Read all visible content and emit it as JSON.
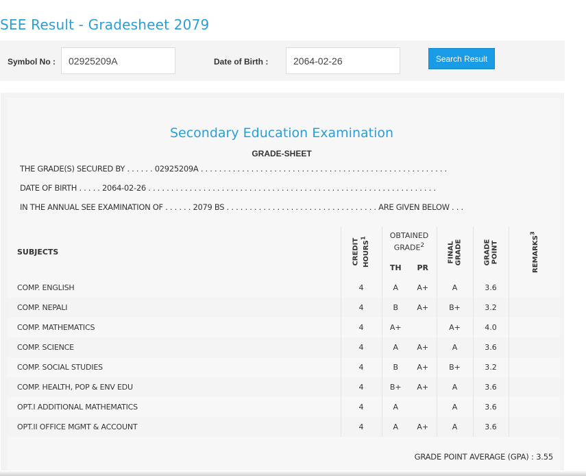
{
  "page": {
    "title": "SEE Result - Gradesheet 2079"
  },
  "search": {
    "symbol_label": "Symbol No :",
    "symbol_value": "02925209A",
    "dob_label": "Date of Birth :",
    "dob_value": "2064-02-26",
    "button_label": "Search Result"
  },
  "sheet": {
    "exam_title": "Secondary Education Examination",
    "heading": "GRADE-SHEET",
    "line1_prefix": "THE GRADE(S) SECURED BY . . . . . .",
    "line1_value": "02925209A",
    "line1_suffix": ". . . . . . . . . . . . . . . . . . . . . . . . . . . . . . . . . . . . . . . . . . . . . . . . . . . . . .",
    "line2_prefix": "DATE OF BIRTH . . . . .",
    "line2_value": "2064-02-26",
    "line2_suffix": ". . . . . . . . . . . . . . . . . . . . . . . . . . . . . . . . . . . . . . . . . . . . . . . . . . . . . . . . . . . . . . .",
    "line3_prefix": "IN THE ANNUAL SEE EXAMINATION OF . . . . . .",
    "line3_value": "2079 BS",
    "line3_suffix": ". . . . . . . . . . . . . . . . . . . . . . . . . . . . . . . . . ARE GIVEN BELOW . . .",
    "columns": {
      "subjects": "SUBJECTS",
      "credit_hours_a": "CREDIT",
      "credit_hours_b": "HOURS",
      "credit_sup": "1",
      "obtained_a": "OBTAINED",
      "obtained_b": "GRADE",
      "obtained_sup": "2",
      "th": "TH",
      "pr": "PR",
      "final_a": "FINAL",
      "final_b": "GRADE",
      "point_a": "GRADE",
      "point_b": "POINT",
      "remarks": "REMARKS",
      "remarks_sup": "3"
    },
    "rows": [
      {
        "subject": "COMP. ENGLISH",
        "credit": "4",
        "th": "A",
        "pr": "A+",
        "final": "A",
        "point": "3.6",
        "remarks": ""
      },
      {
        "subject": "COMP. NEPALI",
        "credit": "4",
        "th": "B",
        "pr": "A+",
        "final": "B+",
        "point": "3.2",
        "remarks": ""
      },
      {
        "subject": "COMP. MATHEMATICS",
        "credit": "4",
        "th": "A+",
        "pr": "",
        "final": "A+",
        "point": "4.0",
        "remarks": ""
      },
      {
        "subject": "COMP. SCIENCE",
        "credit": "4",
        "th": "A",
        "pr": "A+",
        "final": "A",
        "point": "3.6",
        "remarks": ""
      },
      {
        "subject": "COMP. SOCIAL STUDIES",
        "credit": "4",
        "th": "B",
        "pr": "A+",
        "final": "B+",
        "point": "3.2",
        "remarks": ""
      },
      {
        "subject": "COMP. HEALTH, POP & ENV EDU",
        "credit": "4",
        "th": "B+",
        "pr": "A+",
        "final": "A",
        "point": "3.6",
        "remarks": ""
      },
      {
        "subject": "OPT.I ADDITIONAL MATHEMATICS",
        "credit": "4",
        "th": "A",
        "pr": "",
        "final": "A",
        "point": "3.6",
        "remarks": ""
      },
      {
        "subject": "OPT.II OFFICE MGMT & ACCOUNT",
        "credit": "4",
        "th": "A",
        "pr": "A+",
        "final": "A",
        "point": "3.6",
        "remarks": ""
      }
    ],
    "gpa_label": "GRADE POINT AVERAGE (GPA) :",
    "gpa_value": "3.55"
  },
  "colors": {
    "accent": "#2a9fd6",
    "button": "#1a9be6"
  }
}
